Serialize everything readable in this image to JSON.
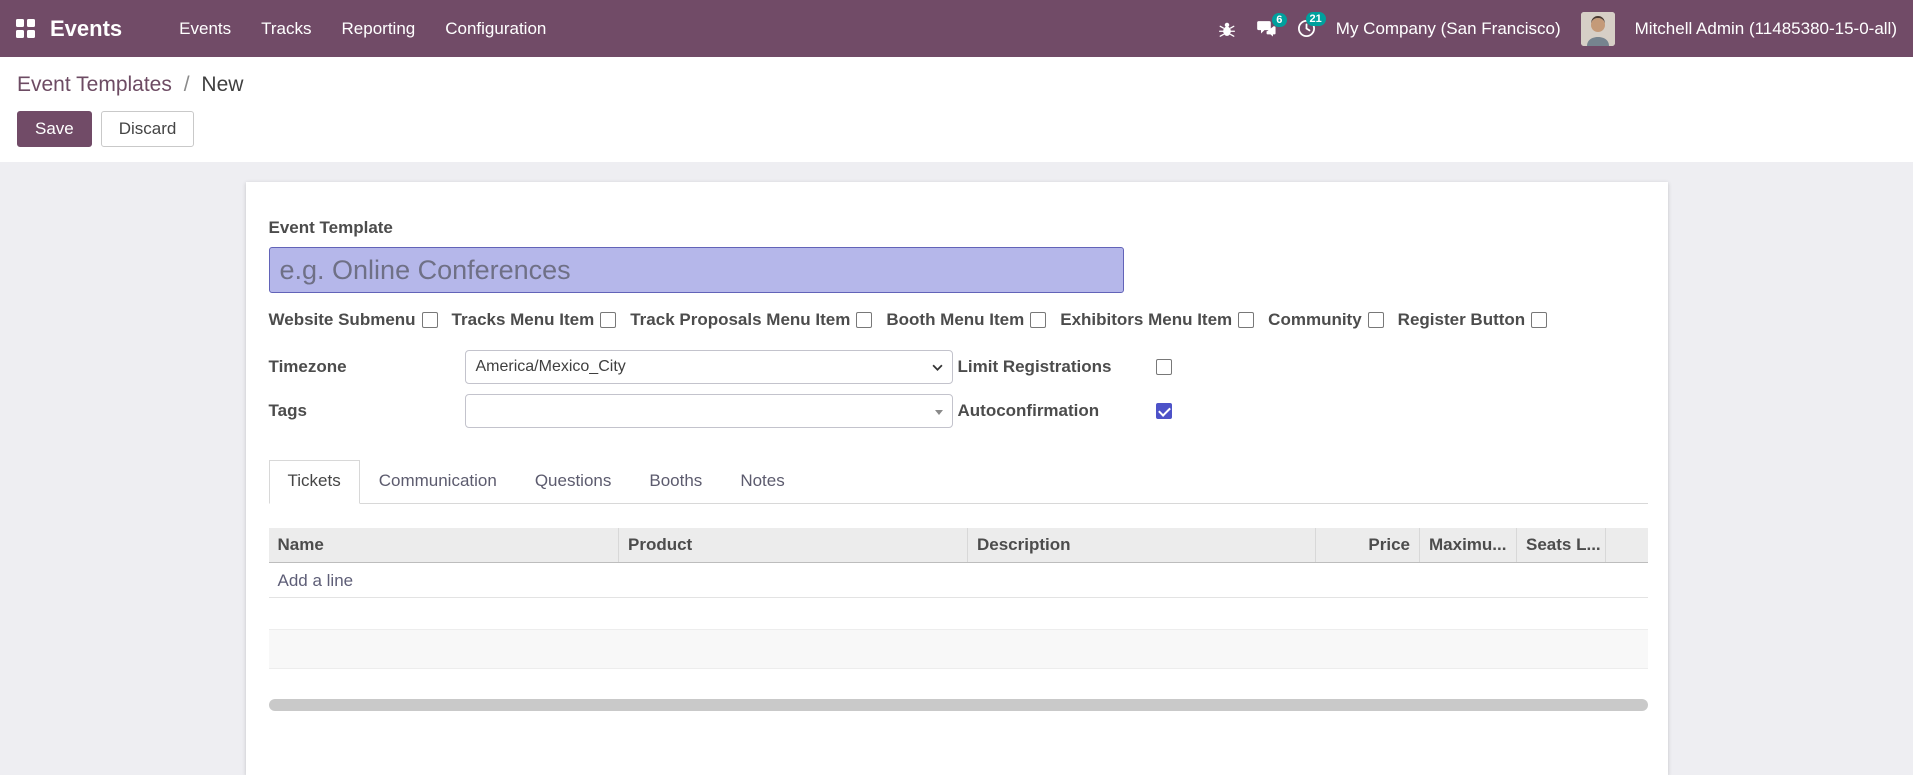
{
  "navbar": {
    "brand": "Events",
    "menus": [
      {
        "label": "Events"
      },
      {
        "label": "Tracks"
      },
      {
        "label": "Reporting"
      },
      {
        "label": "Configuration"
      }
    ],
    "messages_badge": "6",
    "activities_badge": "21",
    "company": "My Company (San Francisco)",
    "user": "Mitchell Admin (11485380-15-0-all)"
  },
  "breadcrumb": {
    "parent": "Event Templates",
    "separator": "/",
    "current": "New"
  },
  "actions": {
    "save": "Save",
    "discard": "Discard"
  },
  "form": {
    "name_label": "Event Template",
    "name_placeholder": "e.g. Online Conferences",
    "name_value": "",
    "options": [
      {
        "label": "Website Submenu",
        "checked": false
      },
      {
        "label": "Tracks Menu Item",
        "checked": false
      },
      {
        "label": "Track Proposals Menu Item",
        "checked": false
      },
      {
        "label": "Booth Menu Item",
        "checked": false
      },
      {
        "label": "Exhibitors Menu Item",
        "checked": false
      },
      {
        "label": "Community",
        "checked": false
      },
      {
        "label": "Register Button",
        "checked": false
      }
    ],
    "timezone": {
      "label": "Timezone",
      "value": "America/Mexico_City"
    },
    "tags": {
      "label": "Tags",
      "value": ""
    },
    "limit_registrations": {
      "label": "Limit Registrations",
      "checked": false
    },
    "autoconfirmation": {
      "label": "Autoconfirmation",
      "checked": true
    }
  },
  "tabs": [
    {
      "label": "Tickets",
      "active": true
    },
    {
      "label": "Communication",
      "active": false
    },
    {
      "label": "Questions",
      "active": false
    },
    {
      "label": "Booths",
      "active": false
    },
    {
      "label": "Notes",
      "active": false
    }
  ],
  "tickets_table": {
    "columns": [
      "Name",
      "Product",
      "Description",
      "Price",
      "Maximu...",
      "Seats L..."
    ],
    "add_line_label": "Add a line",
    "rows": []
  },
  "colors": {
    "navbar_bg": "#714B67",
    "badge": "#00A09D",
    "primary_button": "#714B67",
    "checkbox_accent": "#4d52c8",
    "input_highlight": "#b5b7ea"
  }
}
